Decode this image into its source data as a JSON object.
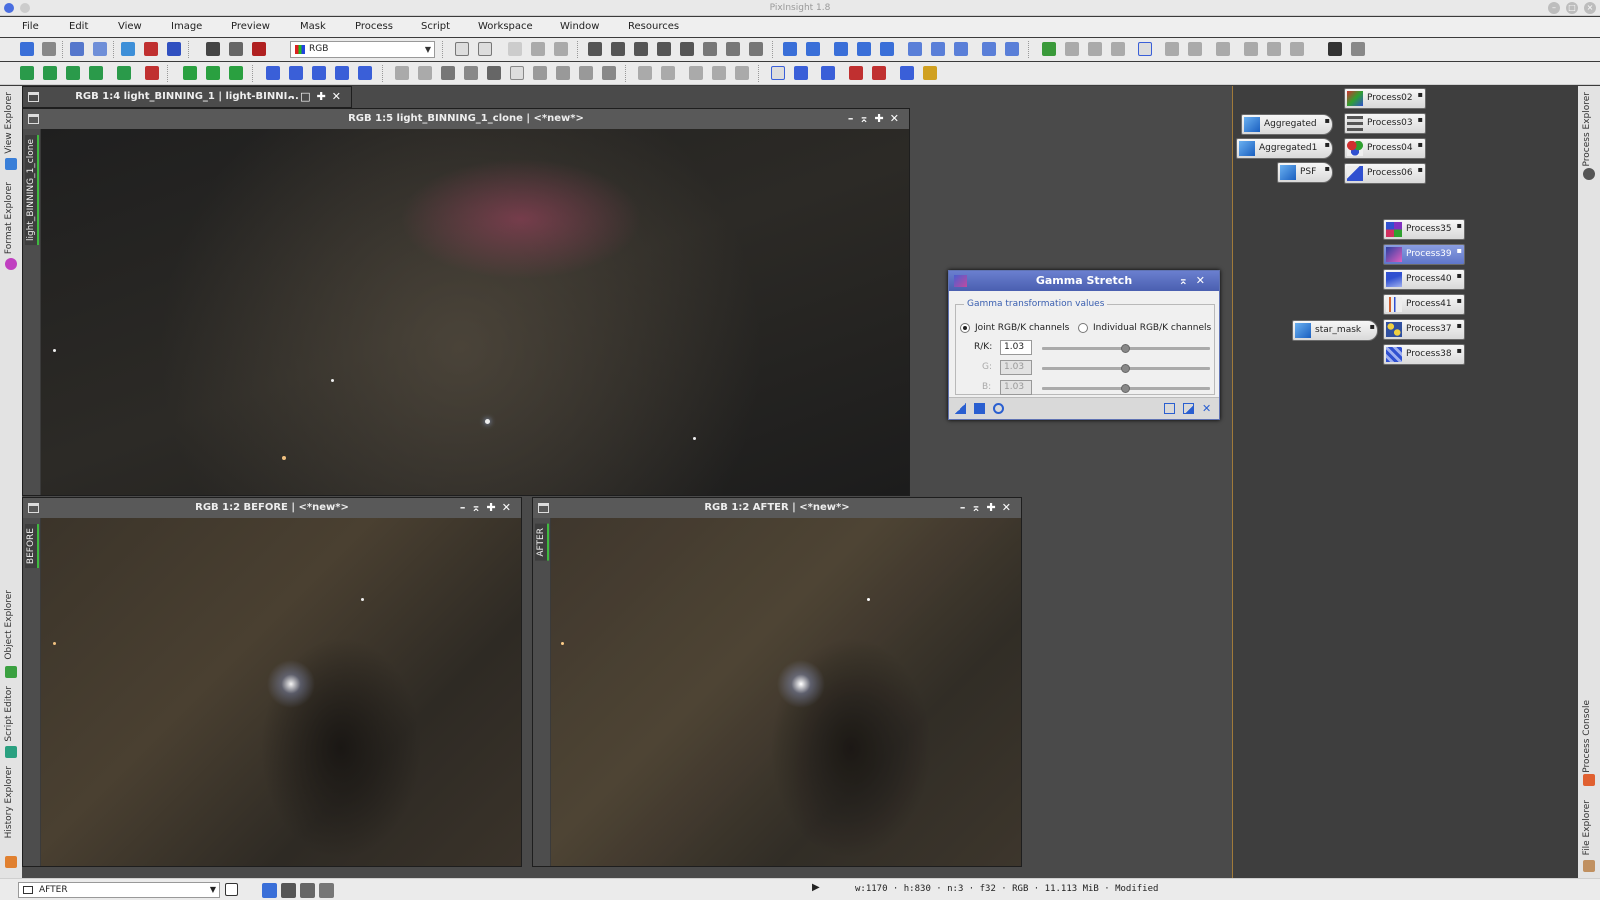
{
  "app": {
    "title": "PixInsight 1.8"
  },
  "menu": [
    "File",
    "Edit",
    "View",
    "Image",
    "Preview",
    "Mask",
    "Process",
    "Script",
    "Workspace",
    "Window",
    "Resources"
  ],
  "toolbar": {
    "color_space": "RGB"
  },
  "left_tabs": {
    "view_explorer": "View Explorer",
    "format_explorer": "Format Explorer",
    "object_explorer": "Object Explorer",
    "script_editor": "Script Editor",
    "history_explorer": "History Explorer"
  },
  "right_tabs": {
    "process_explorer": "Process Explorer",
    "process_console": "Process Console",
    "file_explorer": "File Explorer"
  },
  "windows": {
    "back": {
      "title": "RGB 1:4 light_BINNING_1 | light-BINNI..."
    },
    "main": {
      "title": "RGB 1:5 light_BINNING_1_clone | <*new*>",
      "side": "light_BINNING_1_clone"
    },
    "before": {
      "title": "RGB 1:2 BEFORE | <*new*>",
      "side": "BEFORE"
    },
    "after": {
      "title": "RGB 1:2 AFTER | <*new*>",
      "side": "AFTER"
    }
  },
  "gamma": {
    "title": "Gamma Stretch",
    "group": "Gamma transformation values",
    "joint": "Joint RGB/K channels",
    "individual": "Individual RGB/K channels",
    "rk_label": "R/K:",
    "g_label": "G:",
    "b_label": "B:",
    "rk": "1.03",
    "g": "1.03",
    "b": "1.03",
    "slider_level": 0.5
  },
  "icons": [
    {
      "label": "Process02"
    },
    {
      "label": "Process03"
    },
    {
      "label": "Process04"
    },
    {
      "label": "Process06"
    },
    {
      "label": "Aggregated"
    },
    {
      "label": "Aggregated1"
    },
    {
      "label": "PSF"
    },
    {
      "label": "Process35"
    },
    {
      "label": "Process39"
    },
    {
      "label": "Process40"
    },
    {
      "label": "Process41"
    },
    {
      "label": "Process37"
    },
    {
      "label": "Process38"
    },
    {
      "label": "star_mask"
    }
  ],
  "status": {
    "view": "AFTER",
    "info": "w:1170 · h:830 · n:3 · f32 · RGB · 11.113 MiB · Modified"
  },
  "colors": {
    "accent": "#5a6fc0",
    "selected_icon": "#6a80d6",
    "tab_marker": "#3fba3f"
  }
}
